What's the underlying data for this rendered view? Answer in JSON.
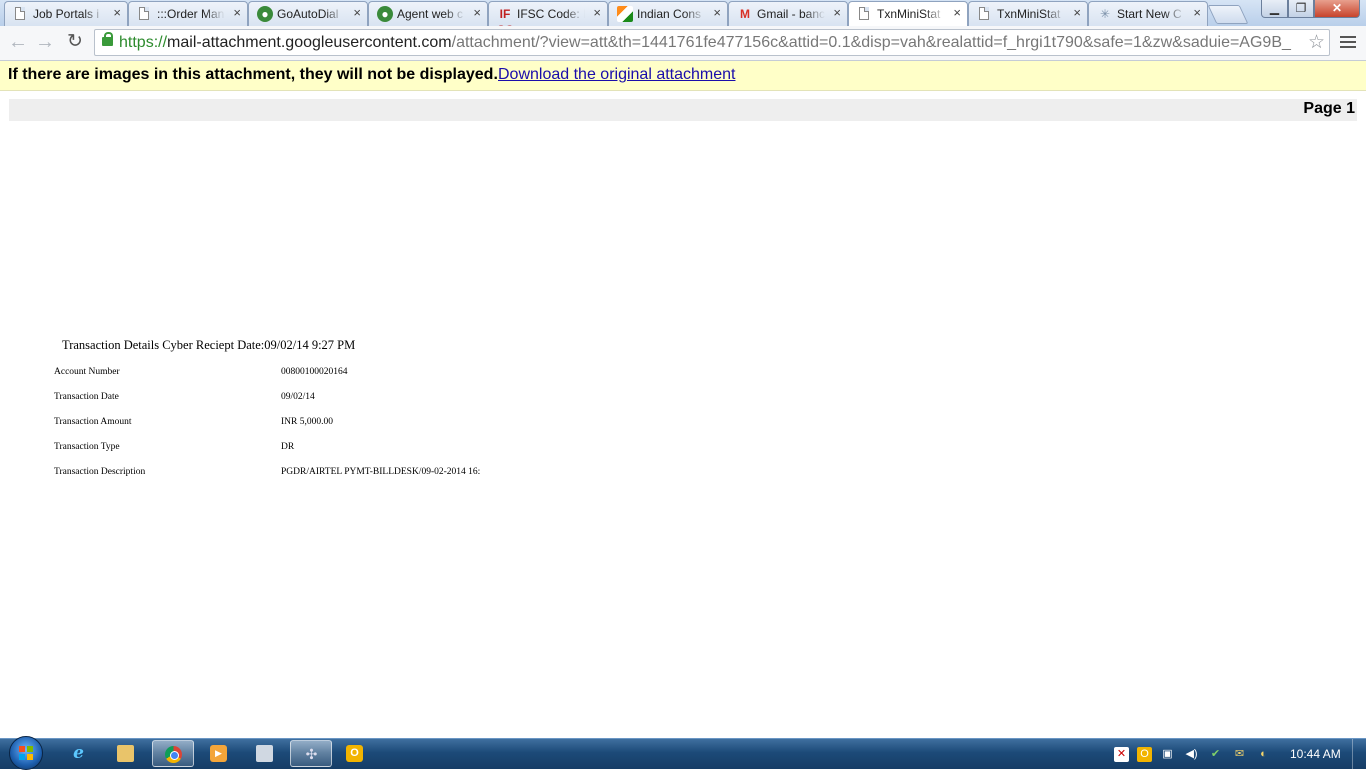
{
  "browser": {
    "tabs": [
      {
        "label": "Job Portals i",
        "icon": "document-icon",
        "active": false
      },
      {
        "label": ":::Order Man",
        "icon": "document-icon",
        "active": false
      },
      {
        "label": "GoAutoDial",
        "icon": "globe-icon",
        "active": false
      },
      {
        "label": "Agent web c",
        "icon": "globe-icon",
        "active": false
      },
      {
        "label": "IFSC Code: I",
        "icon": "ifsc-icon",
        "active": false
      },
      {
        "label": "Indian Cons",
        "icon": "flag-icon",
        "active": false
      },
      {
        "label": "Gmail - banc",
        "icon": "gmail-icon",
        "active": false
      },
      {
        "label": "TxnMiniStat",
        "icon": "document-icon",
        "active": true
      },
      {
        "label": "TxnMiniStat",
        "icon": "document-icon",
        "active": false
      },
      {
        "label": "Start New C",
        "icon": "star-icon",
        "active": false
      }
    ],
    "close_glyph": "×",
    "url": {
      "scheme": "https://",
      "host": "mail-attachment.googleusercontent.com",
      "path": "/attachment/?view=att&th=1441761fe477156c&attid=0.1&disp=vah&realattid=f_hrgi1t790&safe=1&zw&saduie=AG9B_"
    }
  },
  "infobar": {
    "message": "If there are images in this attachment, they will not be displayed.",
    "link": "Download the original attachment"
  },
  "document": {
    "page_label": "Page 1",
    "title": "Transaction Details Cyber Reciept Date:09/02/14 9:27 PM",
    "rows": [
      {
        "label": "Account Number",
        "value": "00800100020164"
      },
      {
        "label": "Transaction Date",
        "value": "09/02/14"
      },
      {
        "label": "Transaction Amount",
        "value": "INR 5,000.00"
      },
      {
        "label": "Transaction Type",
        "value": "DR"
      },
      {
        "label": "Transaction Description",
        "value": "PGDR/AIRTEL PYMT-BILLDESK/09-02-2014 16:"
      }
    ]
  },
  "taskbar": {
    "items": [
      {
        "name": "internet-explorer-icon",
        "active": false
      },
      {
        "name": "windows-explorer-icon",
        "active": false
      },
      {
        "name": "chrome-icon",
        "active": true
      },
      {
        "name": "media-player-icon",
        "active": false
      },
      {
        "name": "calculator-icon",
        "active": false
      },
      {
        "name": "network-icon",
        "active": true
      },
      {
        "name": "outlook-icon",
        "active": false
      }
    ],
    "clock": "10:44 AM"
  }
}
